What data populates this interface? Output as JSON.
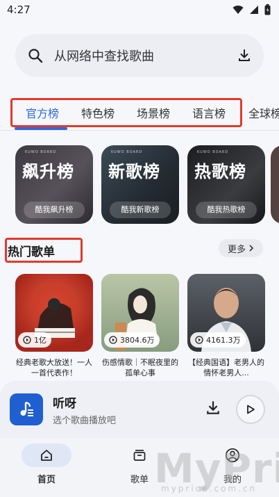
{
  "status": {
    "time": "4:27"
  },
  "search": {
    "placeholder": "从网络中查找歌曲"
  },
  "tabs": [
    {
      "label": "官方榜",
      "active": true
    },
    {
      "label": "特色榜"
    },
    {
      "label": "场景榜"
    },
    {
      "label": "语言榜"
    },
    {
      "label": "全球榜"
    }
  ],
  "boards": [
    {
      "title": "飙升榜",
      "subtitle": "酷我飙升榜",
      "brand": "KUWO BOARD"
    },
    {
      "title": "新歌榜",
      "subtitle": "酷我新歌榜",
      "brand": "KUWO BOARD"
    },
    {
      "title": "热歌榜",
      "subtitle": "酷我热歌榜",
      "brand": "KUWO BOARD"
    }
  ],
  "hot": {
    "title": "热门歌单",
    "more": "更多"
  },
  "playlists": [
    {
      "count": "1亿",
      "name": "经典老歌大放送！一人一首代表作！"
    },
    {
      "count": "3804.6万",
      "name": "伤感情歌｜不眠夜里的孤单心事"
    },
    {
      "count": "4161.3万",
      "name": "【经典国语】老男人的情怀老男人..."
    }
  ],
  "player": {
    "title": "听呀",
    "subtitle": "选个歌曲播放吧"
  },
  "nav": [
    {
      "label": "首页",
      "active": true
    },
    {
      "label": "歌单"
    },
    {
      "label": "我的"
    }
  ],
  "watermark": {
    "main": "MyPrice",
    "sub": "myprice.com.cn"
  },
  "colors": {
    "accent": "#2f6ad9",
    "highlight_frame": "#e2392b"
  }
}
